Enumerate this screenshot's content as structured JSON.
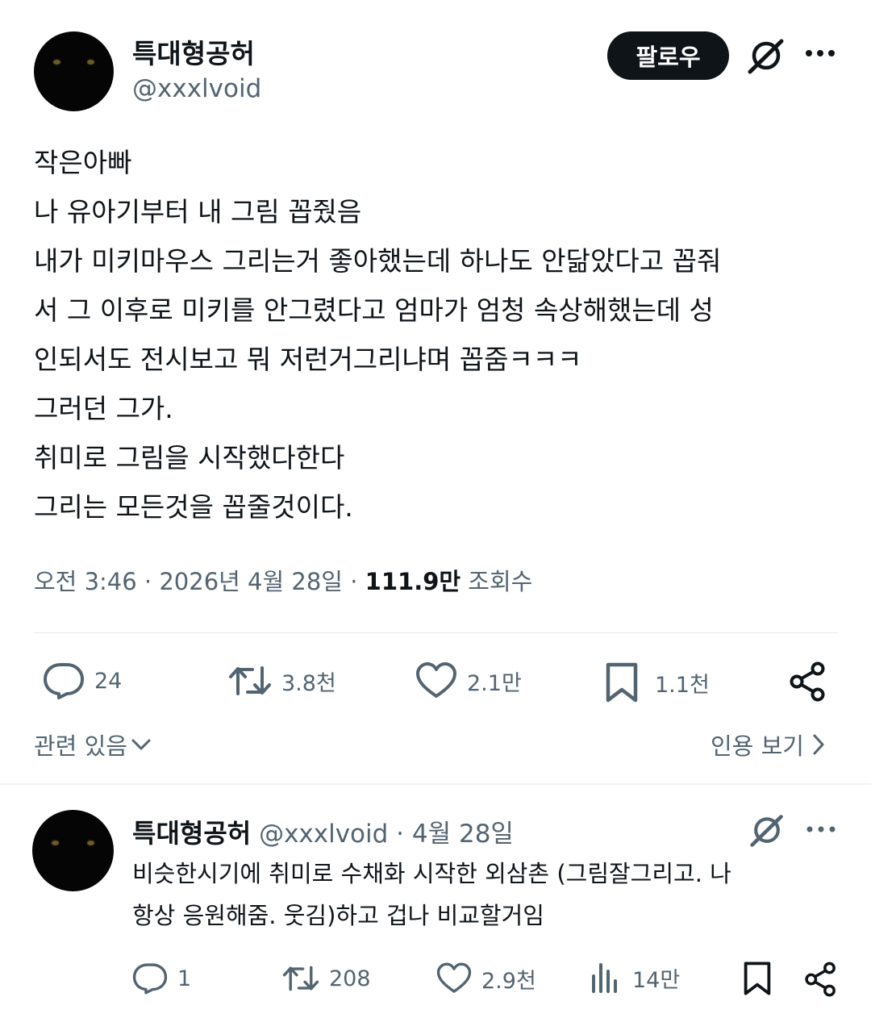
{
  "post": {
    "author_name": "특대형공허",
    "author_handle": "@xxxlvoid",
    "follow_label": "팔로우",
    "body_lines": [
      "작은아빠",
      "나 유아기부터 내 그림 꼽줬음",
      "내가 미키마우스 그리는거 좋아했는데 하나도 안닮았다고 꼽줘",
      "서 그 이후로 미키를 안그렸다고 엄마가 엄청 속상해했는데 성",
      "인되서도 전시보고 뭐 저런거그리냐며 꼽줌ㅋㅋㅋ",
      "그러던 그가.",
      "취미로 그림을 시작했다한다",
      "그리는 모든것을 꼽줄것이다."
    ],
    "time": "오전 3:46",
    "date": "2026년 4월 28일",
    "views_count": "111.9만",
    "views_label": "조회수",
    "actions": {
      "replies": "24",
      "reposts": "3.8천",
      "likes": "2.1만",
      "bookmarks": "1.1천"
    },
    "related_label": "관련 있음",
    "quotes_label": "인용 보기"
  },
  "reply": {
    "author_name": "특대형공허",
    "author_handle": "@xxxlvoid",
    "date": "4월 28일",
    "body_lines": [
      "비슷한시기에 취미로 수채화 시작한 외삼촌 (그림잘그리고. 나",
      "항상 응원해줌. 웃김)하고 겁나 비교할거임"
    ],
    "actions": {
      "replies": "1",
      "reposts": "208",
      "likes": "2.9천",
      "views": "14만"
    }
  },
  "icons": {
    "grok": "grok-icon",
    "more": "more-icon",
    "reply": "reply-icon",
    "repost": "repost-icon",
    "like": "like-icon",
    "bookmark": "bookmark-icon",
    "share": "share-icon",
    "views": "views-icon",
    "chevron": "chevron-icon"
  },
  "colors": {
    "text": "#0f1419",
    "secondary": "#536471",
    "follow_bg": "#0f1419",
    "divider": "#e7e9eb"
  }
}
